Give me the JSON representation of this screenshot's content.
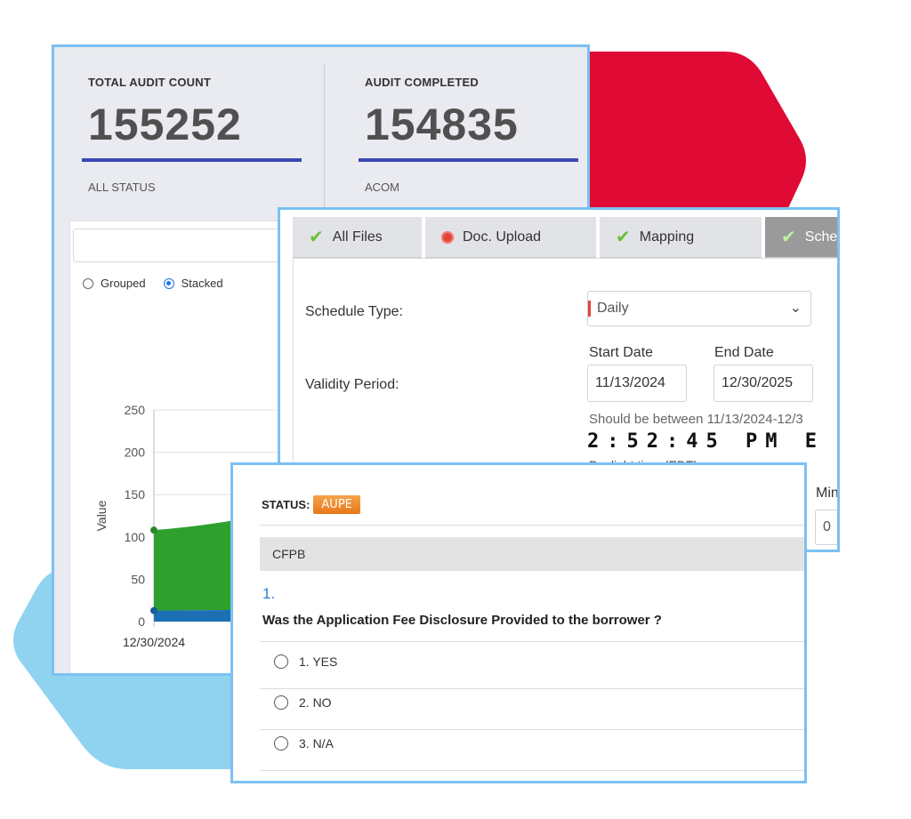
{
  "dashboard": {
    "stats": [
      {
        "label": "TOTAL AUDIT COUNT",
        "value": "155252",
        "sub": "ALL STATUS"
      },
      {
        "label": "AUDIT COMPLETED",
        "value": "154835",
        "sub": "ACOM"
      }
    ],
    "chart_options": {
      "grouped": "Grouped",
      "stacked": "Stacked",
      "selected": "Stacked"
    }
  },
  "chart_data": {
    "type": "area",
    "stacked": true,
    "ylabel": "Value",
    "ylim": [
      0,
      250
    ],
    "yticks": [
      "250",
      "200",
      "150",
      "100",
      "50",
      "0"
    ],
    "x": [
      "12/30/2024"
    ],
    "series": [
      {
        "color": "#1c6fb5",
        "values": [
          13,
          15
        ]
      },
      {
        "color": "#2ea02e",
        "values": [
          95,
          140
        ]
      }
    ],
    "grid": true
  },
  "schedule": {
    "tabs": [
      {
        "label": "All Files",
        "icon": "check-icon"
      },
      {
        "label": "Doc. Upload",
        "icon": "red-dot-icon"
      },
      {
        "label": "Mapping",
        "icon": "check-icon"
      },
      {
        "label": "Sche",
        "icon": "check-icon",
        "active": true
      }
    ],
    "schedule_type_label": "Schedule Type:",
    "schedule_type_value": "Daily",
    "validity_label": "Validity Period:",
    "start_date_label": "Start Date",
    "start_date": "11/13/2024",
    "end_date_label": "End Date",
    "end_date": "12/30/2025",
    "hint": "Should be between 11/13/2024-12/3",
    "clock": "2:52:45 PM E",
    "tz": "Daylight time (EDT)",
    "min_label": "Min",
    "min_value": "0"
  },
  "question": {
    "status_label": "STATUS:",
    "status_badge": "AUPE",
    "section": "CFPB",
    "number": "1.",
    "text": "Was the Application Fee Disclosure Provided to the borrower ?",
    "options": [
      "1. YES",
      "2. NO",
      "3. N/A"
    ]
  },
  "colors": {
    "border": "#7cc0f3",
    "accent_red": "#e00b35",
    "accent_blue_bg": "#8fd3f0",
    "stat_bar": "#3b46b3",
    "badge": "#e8771a"
  }
}
